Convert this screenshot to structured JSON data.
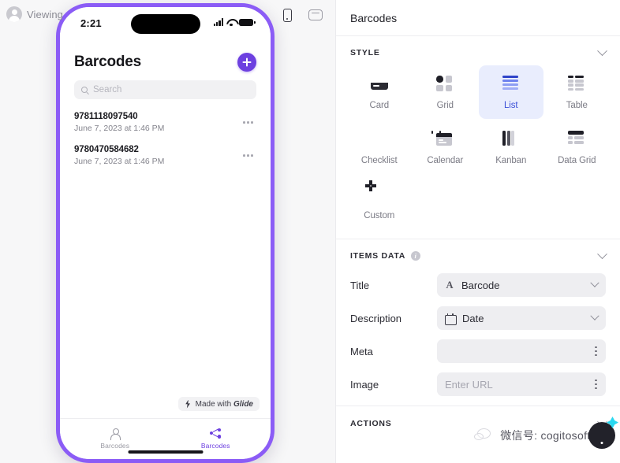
{
  "canvas": {
    "viewing_label": "Viewing",
    "device_toggles": [
      {
        "name": "phone",
        "icon": "phone-icon",
        "active": true
      },
      {
        "name": "tablet",
        "icon": "tablet-icon",
        "active": false
      }
    ]
  },
  "phone": {
    "status_bar": {
      "time": "2:21",
      "signal_icon": "cellular-signal-icon",
      "wifi_icon": "wifi-icon",
      "battery_icon": "battery-icon"
    },
    "app_title": "Barcodes",
    "add_button_icon": "plus-icon",
    "search": {
      "placeholder": "Search",
      "icon": "search-icon"
    },
    "list_items": [
      {
        "title": "9781118097540",
        "subtitle": "June 7, 2023 at 1:46 PM",
        "menu_icon": "more-horizontal-icon"
      },
      {
        "title": "9780470584682",
        "subtitle": "June 7, 2023 at 1:46 PM",
        "menu_icon": "more-horizontal-icon"
      }
    ],
    "made_with": {
      "prefix": "Made with ",
      "brand": "Glide",
      "icon": "bolt-icon"
    },
    "tabs": [
      {
        "label": "Barcodes",
        "icon": "person-icon",
        "active": false
      },
      {
        "label": "Barcodes",
        "icon": "share-nodes-icon",
        "active": true
      }
    ]
  },
  "panel": {
    "title": "Barcodes",
    "style_section": {
      "heading": "STYLE",
      "collapse_icon": "chevron-down-icon",
      "options": [
        {
          "label": "Card",
          "icon": "card-style-icon",
          "active": false
        },
        {
          "label": "Grid",
          "icon": "grid-style-icon",
          "active": false
        },
        {
          "label": "List",
          "icon": "list-style-icon",
          "active": true
        },
        {
          "label": "Table",
          "icon": "table-style-icon",
          "active": false
        },
        {
          "label": "Checklist",
          "icon": "checklist-style-icon",
          "active": false
        },
        {
          "label": "Calendar",
          "icon": "calendar-style-icon",
          "active": false
        },
        {
          "label": "Kanban",
          "icon": "kanban-style-icon",
          "active": false
        },
        {
          "label": "Data Grid",
          "icon": "data-grid-style-icon",
          "active": false
        },
        {
          "label": "Custom",
          "icon": "custom-style-icon",
          "active": false
        }
      ]
    },
    "items_data_section": {
      "heading": "ITEMS DATA",
      "info_icon": "info-icon",
      "info_glyph": "i",
      "collapse_icon": "chevron-down-icon",
      "fields": [
        {
          "label": "Title",
          "value": "Barcode",
          "placeholder": "",
          "type_icon": "text-type-icon",
          "control": "dropdown"
        },
        {
          "label": "Description",
          "value": "Date",
          "placeholder": "",
          "type_icon": "date-type-icon",
          "control": "dropdown"
        },
        {
          "label": "Meta",
          "value": "",
          "placeholder": "",
          "type_icon": "",
          "control": "menu"
        },
        {
          "label": "Image",
          "value": "",
          "placeholder": "Enter URL",
          "type_icon": "",
          "control": "menu"
        }
      ]
    },
    "actions_section": {
      "heading": "ACTIONS",
      "collapse_icon": "chevron-down-icon"
    }
  },
  "watermark": {
    "text": "微信号: cogitosoftware",
    "logo_icon": "wechat-icon"
  },
  "colors": {
    "accent_purple": "#6d40e0",
    "phone_frame": "#8b5cf6",
    "active_blue_text": "#3b4fd8",
    "active_blue_bg": "#e9edfd",
    "panel_bg": "#ffffff",
    "canvas_bg": "#f7f7f8"
  }
}
